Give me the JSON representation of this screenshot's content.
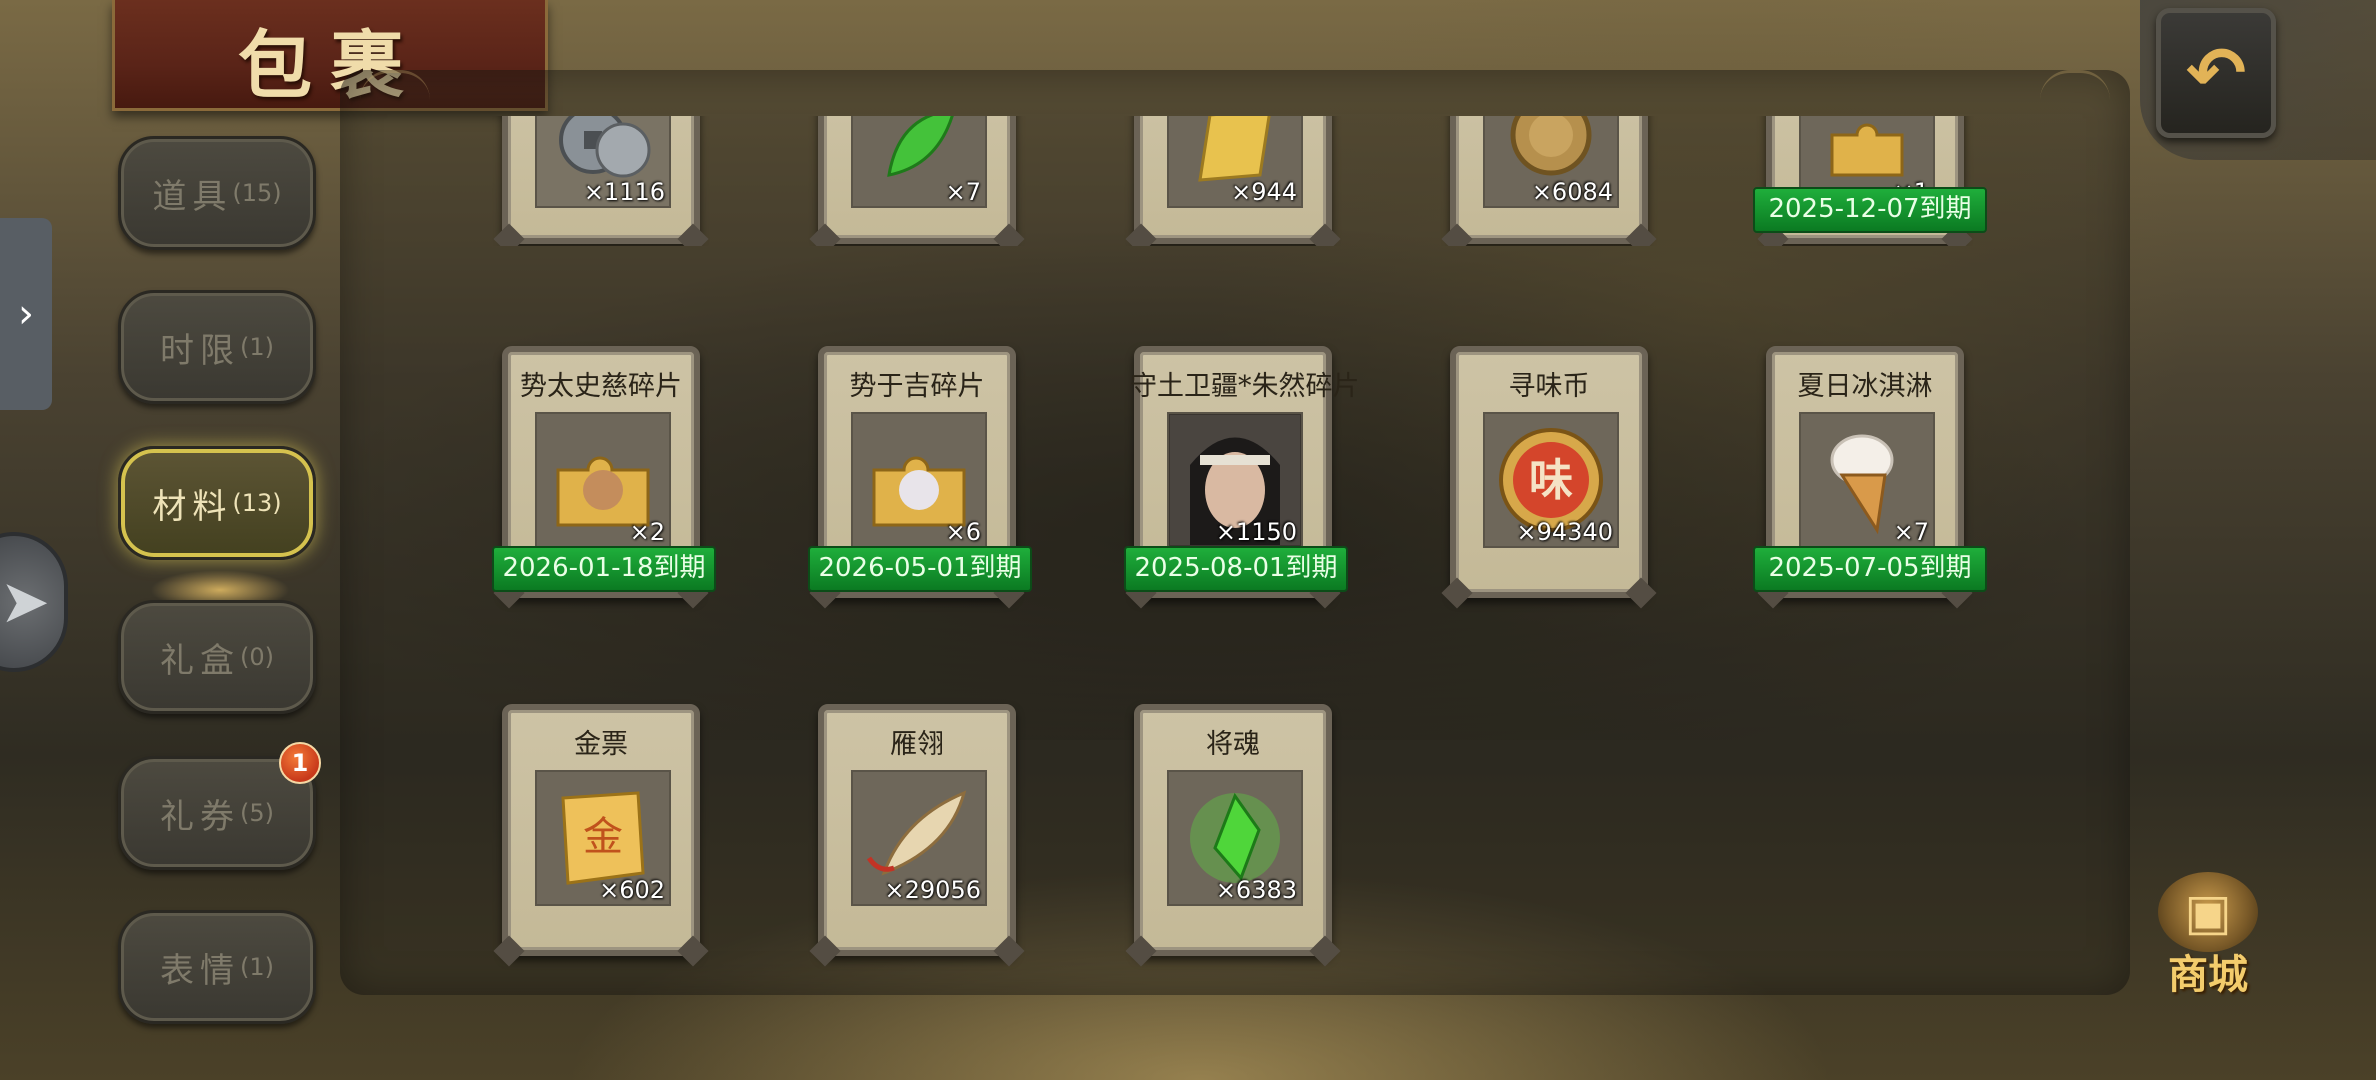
{
  "title": "包裹",
  "tabs": [
    {
      "name": "道具",
      "count": "(15)"
    },
    {
      "name": "时限",
      "count": "(1)"
    },
    {
      "name": "材料",
      "count": "(13)"
    },
    {
      "name": "礼盒",
      "count": "(0)"
    },
    {
      "name": "礼券",
      "count": "(5)"
    },
    {
      "name": "表情",
      "count": "(1)"
    }
  ],
  "active_tab": "材料",
  "badge_count": "1",
  "shop_label": "商城",
  "items_row1": [
    {
      "qty": "×1116",
      "icon": "coins-icon"
    },
    {
      "qty": "×7",
      "icon": "green-leaf-icon"
    },
    {
      "qty": "×944",
      "icon": "gold-ingot-icon"
    },
    {
      "qty": "×6084",
      "icon": "bronze-coin-icon"
    },
    {
      "qty": "×1",
      "icon": "puzzle-fragment-icon",
      "expiry": "2025-12-07到期"
    }
  ],
  "items_row2": [
    {
      "name": "势太史慈碎片",
      "qty": "×2",
      "icon": "puzzle-fragment-icon",
      "expiry": "2026-01-18到期"
    },
    {
      "name": "势于吉碎片",
      "qty": "×6",
      "icon": "puzzle-fragment-icon",
      "expiry": "2026-05-01到期"
    },
    {
      "name": "守土卫疆*朱然碎片",
      "qty": "×1150",
      "icon": "hero-portrait-icon",
      "expiry": "2025-08-01到期"
    },
    {
      "name": "寻味币",
      "qty": "×94340",
      "icon": "flavor-coin-icon",
      "coin_char": "味"
    },
    {
      "name": "夏日冰淇淋",
      "qty": "×7",
      "icon": "ice-cream-icon",
      "expiry": "2025-07-05到期"
    }
  ],
  "items_row3": [
    {
      "name": "金票",
      "qty": "×602",
      "icon": "gold-ticket-icon",
      "ticket_char": "金"
    },
    {
      "name": "雁翎",
      "qty": "×29056",
      "icon": "feather-icon"
    },
    {
      "name": "将魂",
      "qty": "×6383",
      "icon": "green-crystal-icon"
    }
  ]
}
